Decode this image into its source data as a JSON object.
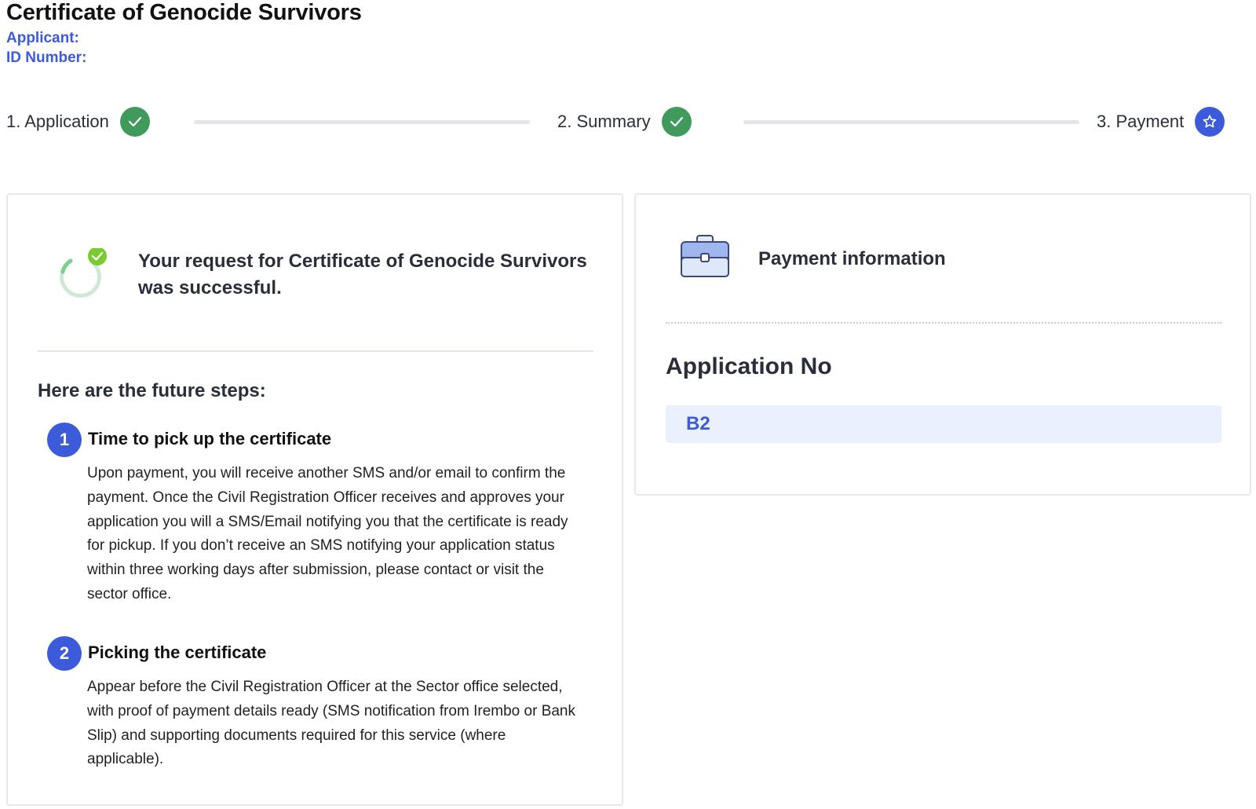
{
  "header": {
    "title": "Certificate of Genocide Survivors",
    "applicant_label": "Applicant:",
    "id_label": "ID Number:"
  },
  "stepper": {
    "steps": [
      {
        "label": "1. Application",
        "status": "done",
        "icon": "check-icon"
      },
      {
        "label": "2. Summary",
        "status": "done",
        "icon": "check-icon"
      },
      {
        "label": "3. Payment",
        "status": "current",
        "icon": "star-icon"
      }
    ]
  },
  "success": {
    "message": "Your request for Certificate of Genocide Survivors was successful.",
    "icon": "success-spinner-icon"
  },
  "future_steps": {
    "title": "Here are the future steps:",
    "items": [
      {
        "number": "1",
        "heading": "Time to pick up the certificate",
        "body": "Upon payment, you will receive another SMS and/or email to confirm the payment. Once the Civil Registration Officer receives and approves your application you will a SMS/Email notifying you that the certificate is ready for pickup. If you don’t receive an SMS notifying your application status within three working days after submission, please contact or visit the sector office."
      },
      {
        "number": "2",
        "heading": "Picking the certificate",
        "body": "Appear before the Civil Registration Officer at the Sector office selected, with proof of payment details ready (SMS notification from Irembo or Bank Slip) and supporting documents required for this service (where applicable)."
      }
    ]
  },
  "payment": {
    "title": "Payment information",
    "icon": "briefcase-icon",
    "application_no_label": "Application No",
    "application_no_value": "B2"
  },
  "colors": {
    "accent": "#3b5bdb",
    "success": "#3f9a5c",
    "highlight_bg": "#eaf0fd"
  }
}
